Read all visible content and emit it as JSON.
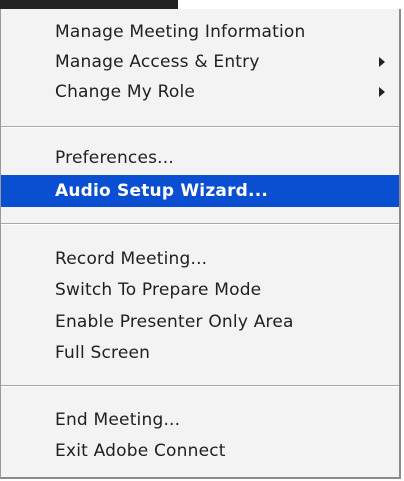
{
  "menu": {
    "group1": {
      "manage_meeting_info": "Manage Meeting Information",
      "manage_access_entry": "Manage Access & Entry",
      "change_my_role": "Change My Role"
    },
    "group2": {
      "preferences": "Preferences...",
      "audio_setup_wizard": "Audio Setup Wizard..."
    },
    "group3": {
      "record_meeting": "Record Meeting...",
      "switch_prepare_mode": "Switch To Prepare Mode",
      "enable_presenter_only_area": "Enable Presenter Only Area",
      "full_screen": "Full Screen"
    },
    "group4": {
      "end_meeting": "End Meeting...",
      "exit_adobe_connect": "Exit Adobe Connect"
    },
    "highlighted_item": "Audio Setup Wizard...",
    "highlight_color": "#0a4fd2",
    "submenu_arrow_icon": "submenu-arrow-icon"
  }
}
